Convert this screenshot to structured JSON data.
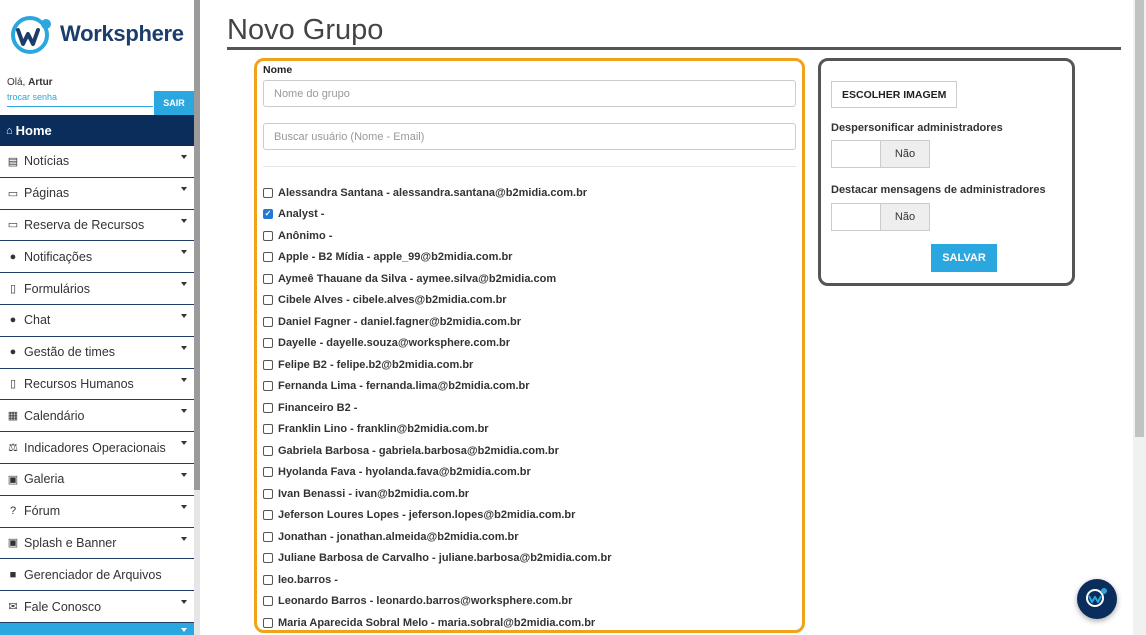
{
  "brand": {
    "name": "Worksphere"
  },
  "user": {
    "greeting": "Olá,",
    "name": "Artur",
    "change_password": "trocar senha",
    "logout": "SAIR"
  },
  "nav": {
    "home": "Home",
    "items": [
      {
        "label": "Notícias",
        "icon": "newspaper-icon",
        "glyph": "▤",
        "caret": true
      },
      {
        "label": "Páginas",
        "icon": "window-icon",
        "glyph": "▭",
        "caret": true
      },
      {
        "label": "Reserva de Recursos",
        "icon": "laptop-icon",
        "glyph": "▭",
        "caret": true
      },
      {
        "label": "Notificações",
        "icon": "info-icon",
        "glyph": "●",
        "caret": true
      },
      {
        "label": "Formulários",
        "icon": "file-icon",
        "glyph": "▯",
        "caret": true
      },
      {
        "label": "Chat",
        "icon": "chat-icon",
        "glyph": "●",
        "caret": true
      },
      {
        "label": "Gestão de times",
        "icon": "users-icon",
        "glyph": "●",
        "caret": true
      },
      {
        "label": "Recursos Humanos",
        "icon": "id-badge-icon",
        "glyph": "▯",
        "caret": true
      },
      {
        "label": "Calendário",
        "icon": "calendar-icon",
        "glyph": "▦",
        "caret": true
      },
      {
        "label": "Indicadores Operacionais",
        "icon": "balance-scale-icon",
        "glyph": "⚖",
        "caret": true
      },
      {
        "label": "Galeria",
        "icon": "image-icon",
        "glyph": "▣",
        "caret": true
      },
      {
        "label": "Fórum",
        "icon": "question-icon",
        "glyph": "?",
        "caret": true
      },
      {
        "label": "Splash e Banner",
        "icon": "picture-frame-icon",
        "glyph": "▣",
        "caret": true
      },
      {
        "label": "Gerenciador de Arquivos",
        "icon": "archive-icon",
        "glyph": "■",
        "caret": false
      },
      {
        "label": "Fale Conosco",
        "icon": "envelope-icon",
        "glyph": "✉",
        "caret": true
      }
    ]
  },
  "page": {
    "title": "Novo Grupo"
  },
  "form": {
    "name_label": "Nome",
    "name_placeholder": "Nome do grupo",
    "search_placeholder": "Buscar usuário (Nome - Email)",
    "users": [
      {
        "label": "Alessandra Santana - alessandra.santana@b2midia.com.br",
        "checked": false
      },
      {
        "label": "Analyst -",
        "checked": true
      },
      {
        "label": "Anônimo -",
        "checked": false
      },
      {
        "label": "Apple - B2 Mídia - apple_99@b2midia.com.br",
        "checked": false
      },
      {
        "label": "Aymeê Thauane da Silva - aymee.silva@b2midia.com",
        "checked": false
      },
      {
        "label": "Cibele Alves - cibele.alves@b2midia.com.br",
        "checked": false
      },
      {
        "label": "Daniel Fagner - daniel.fagner@b2midia.com.br",
        "checked": false
      },
      {
        "label": "Dayelle - dayelle.souza@worksphere.com.br",
        "checked": false
      },
      {
        "label": "Felipe B2 - felipe.b2@b2midia.com.br",
        "checked": false
      },
      {
        "label": "Fernanda Lima - fernanda.lima@b2midia.com.br",
        "checked": false
      },
      {
        "label": "Financeiro B2 -",
        "checked": false
      },
      {
        "label": "Franklin Lino - franklin@b2midia.com.br",
        "checked": false
      },
      {
        "label": "Gabriela Barbosa - gabriela.barbosa@b2midia.com.br",
        "checked": false
      },
      {
        "label": "Hyolanda Fava - hyolanda.fava@b2midia.com.br",
        "checked": false
      },
      {
        "label": "Ivan Benassi - ivan@b2midia.com.br",
        "checked": false
      },
      {
        "label": "Jeferson Loures Lopes - jeferson.lopes@b2midia.com.br",
        "checked": false
      },
      {
        "label": "Jonathan - jonathan.almeida@b2midia.com.br",
        "checked": false
      },
      {
        "label": "Juliane Barbosa de Carvalho - juliane.barbosa@b2midia.com.br",
        "checked": false
      },
      {
        "label": "leo.barros -",
        "checked": false
      },
      {
        "label": "Leonardo Barros - leonardo.barros@worksphere.com.br",
        "checked": false
      },
      {
        "label": "Maria Aparecida Sobral Melo - maria.sobral@b2midia.com.br",
        "checked": false
      }
    ]
  },
  "settings": {
    "choose_image": "ESCOLHER IMAGEM",
    "depersonalize_label": "Despersonificar administradores",
    "depersonalize_value": "Não",
    "highlight_label": "Destacar mensagens de administradores",
    "highlight_value": "Não",
    "save": "SALVAR"
  },
  "colors": {
    "accent": "#2ba7df",
    "nav_dark": "#0a2d5c",
    "users_border": "#f0a319",
    "settings_border": "#555555"
  }
}
